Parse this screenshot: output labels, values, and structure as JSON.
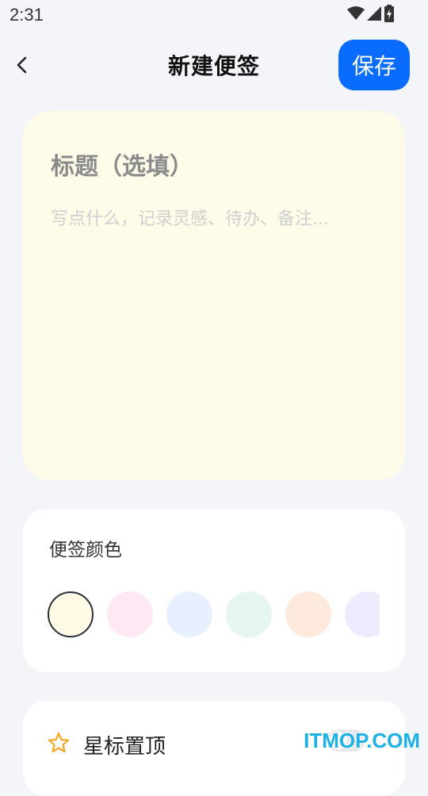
{
  "status_bar": {
    "time": "2:31",
    "icons": [
      "wifi-icon",
      "signal-icon",
      "battery-charging-icon"
    ]
  },
  "header": {
    "back_icon": "chevron-left-icon",
    "title": "新建便签",
    "save_label": "保存"
  },
  "note": {
    "title_placeholder": "标题（选填）",
    "title_value": "",
    "content_placeholder": "写点什么，记录灵感、待办、备注...",
    "content_value": "",
    "background_color": "#fefbe9"
  },
  "color_picker": {
    "label": "便签颜色",
    "selected_index": 0,
    "swatches": [
      "#fffae6",
      "#fde8f3",
      "#e8f0ff",
      "#e5f6ee",
      "#feeadd",
      "#eeebfe"
    ]
  },
  "star_pin": {
    "icon": "star-outline-icon",
    "label": "星标置顶",
    "enabled": false
  },
  "colors": {
    "accent": "#0a6cff",
    "page_background": "#f4f5f9",
    "star_icon": "#f5a623"
  },
  "watermark": "ITMOP.COM"
}
